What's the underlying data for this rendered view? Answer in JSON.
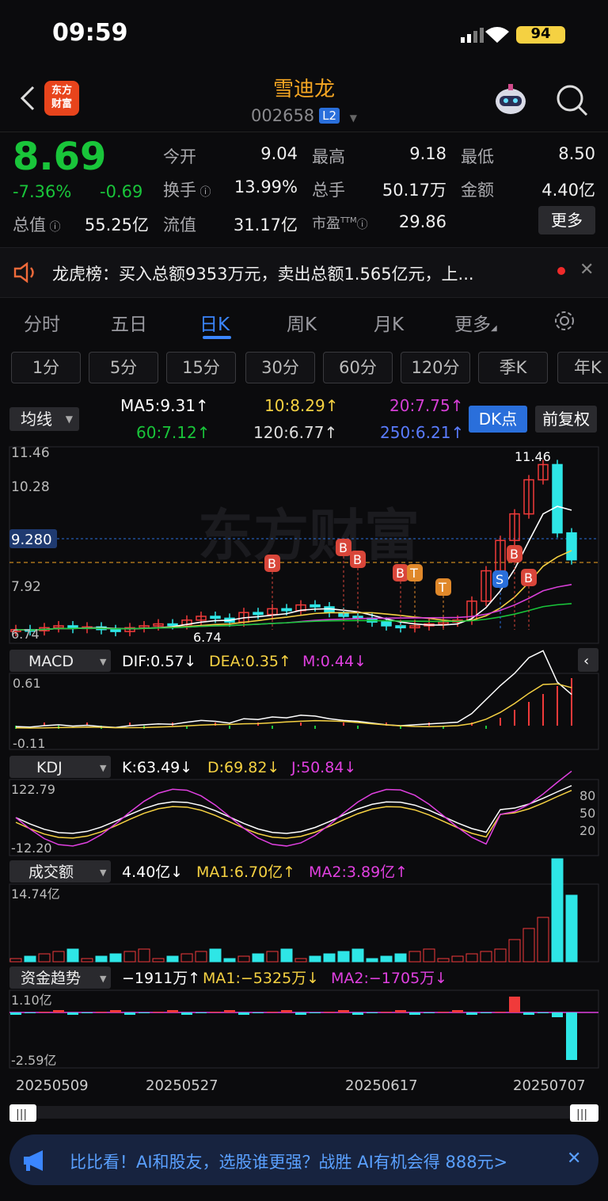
{
  "status": {
    "time": "09:59",
    "battery": "94"
  },
  "header": {
    "title": "雪迪龙",
    "code": "002658",
    "level": "L2",
    "logo": "东方\n财富"
  },
  "quote": {
    "price": "8.69",
    "change_pct": "-7.36%",
    "change": "-0.69",
    "open_label": "今开",
    "open": "9.04",
    "high_label": "最高",
    "high": "9.18",
    "low_label": "最低",
    "low": "8.50",
    "turnover_label": "换手",
    "turnover": "13.99%",
    "volume_label": "总手",
    "volume": "50.17万",
    "amount_label": "金额",
    "amount": "4.40亿",
    "mktcap_label": "总值",
    "mktcap": "55.25亿",
    "float_label": "流值",
    "float": "31.17亿",
    "pe_label": "市盈",
    "pe_sup": "TTM",
    "pe": "29.86",
    "more": "更多"
  },
  "news": {
    "text": "龙虎榜：买入总额9353万元，卖出总额1.565亿元，上..."
  },
  "tabs": [
    "分时",
    "五日",
    "日K",
    "周K",
    "月K",
    "更多"
  ],
  "periods": [
    "1分",
    "5分",
    "15分",
    "30分",
    "60分",
    "120分",
    "季K",
    "年K"
  ],
  "ma": {
    "selector": "均线",
    "ma5": "MA5:9.31↑",
    "ma10": "10:8.29↑",
    "ma20": "20:7.75↑",
    "ma60": "60:7.12↑",
    "ma120": "120:6.77↑",
    "ma250": "250:6.21↑",
    "dk": "DK点",
    "fq": "前复权",
    "colors": {
      "ma5": "#ffffff",
      "ma10": "#f5d142",
      "ma20": "#d63fd6",
      "ma60": "#19c53a",
      "ma120": "#ffffff",
      "ma250": "#4a6cf7"
    }
  },
  "kline": {
    "y_labels": [
      "11.46",
      "10.28",
      "9.280",
      "7.92",
      "6.74"
    ],
    "high_label": "11.46",
    "low_label": "6.74"
  },
  "macd": {
    "selector": "MACD",
    "dif": "DIF:0.57↓",
    "dea": "DEA:0.35↑",
    "m": "M:0.44↓",
    "y_top": "0.61",
    "y_bottom": "-0.11"
  },
  "kdj": {
    "selector": "KDJ",
    "k": "K:63.49↓",
    "d": "D:69.82↓",
    "j": "J:50.84↓",
    "y_top": "122.79",
    "y_bottom": "-12.20",
    "levels": [
      "80",
      "50",
      "20"
    ]
  },
  "amount_ind": {
    "selector": "成交额",
    "val": "4.40亿↓",
    "ma1": "MA1:6.70亿↑",
    "ma2": "MA2:3.89亿↑",
    "y_top": "14.74亿"
  },
  "fund": {
    "selector": "资金趋势",
    "val": "−1911万↑",
    "ma1": "MA1:−5325万↓",
    "ma2": "MA2:−1705万↓",
    "y_top": "1.10亿",
    "y_bottom": "-2.59亿"
  },
  "dates": [
    "20250509",
    "20250527",
    "20250617",
    "20250707"
  ],
  "promo": {
    "text": "比比看！AI和股友，选股谁更强？战胜 AI有机会得 888元>"
  }
}
